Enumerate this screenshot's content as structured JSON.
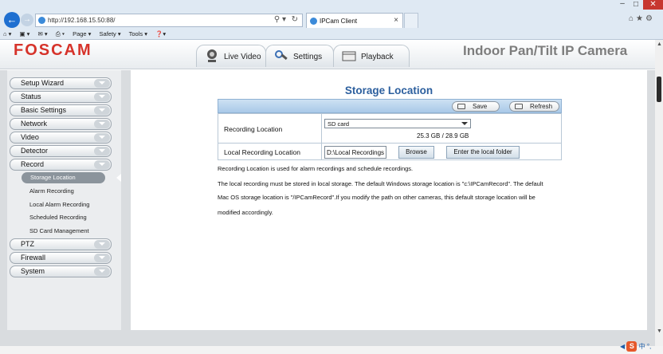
{
  "browser": {
    "url": "http://192.168.15.50:88/",
    "tab_title": "IPCam Client",
    "command_bar": [
      "Page ▾",
      "Safety ▾",
      "Tools ▾"
    ]
  },
  "app": {
    "logo": "FOSCAM",
    "product_title": "Indoor Pan/Tilt IP Camera",
    "tabs": [
      "Live Video",
      "Settings",
      "Playback"
    ]
  },
  "sidebar": {
    "items_top": [
      "Setup Wizard",
      "Status",
      "Basic Settings",
      "Network",
      "Video",
      "Detector",
      "Record"
    ],
    "record_sub": [
      "Storage Location",
      "Alarm Recording",
      "Local Alarm Recording",
      "Scheduled Recording",
      "SD Card Management"
    ],
    "items_bottom": [
      "PTZ",
      "Firewall",
      "System"
    ]
  },
  "page": {
    "title": "Storage Location",
    "save_label": "Save",
    "refresh_label": "Refresh",
    "recording_location_label": "Recording Location",
    "recording_location_value": "SD card",
    "capacity": "25.3 GB / 28.9 GB",
    "local_recording_label": "Local Recording Location",
    "local_recording_value": "D:\\Local Recordings",
    "browse_label": "Browse",
    "enter_folder_label": "Enter the local folder",
    "notes": [
      "Recording Location is used for alarm recordings and schedule recordings.",
      "The local recording must be stored in local storage. The default Windows storage location is \"c:\\IPCamRecord\". The default",
      "Mac OS storage location is \"/IPCamRecord\".If you modify the path on other cameras, this default storage location will be",
      "modified accordingly."
    ]
  },
  "tray": {
    "s_label": "S",
    "ime_label": "中"
  },
  "colors": {
    "logo": "#d6332a",
    "title": "#2c5f9e",
    "toolbar": "#a9c9e8"
  }
}
